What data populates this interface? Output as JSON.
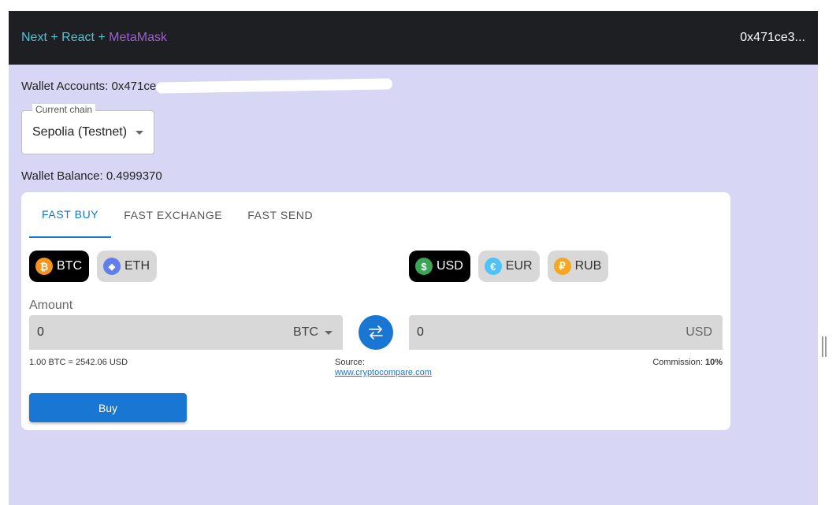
{
  "header": {
    "brand_part1": "Next + React + ",
    "brand_part2": "MetaMask",
    "account_short": "0x471ce3..."
  },
  "wallet": {
    "accounts_label": "Wallet Accounts: 0x471ce",
    "balance_label": "Wallet Balance: 0.4999370"
  },
  "chain_select": {
    "legend": "Current chain",
    "value": "Sepolia (Testnet)"
  },
  "tabs": [
    {
      "label": "FAST BUY",
      "active": true
    },
    {
      "label": "FAST EXCHANGE",
      "active": false
    },
    {
      "label": "FAST SEND",
      "active": false
    }
  ],
  "crypto_chips": [
    {
      "label": "BTC",
      "icon": "bitcoin-icon",
      "symbol": "₿",
      "color": "#f7931a",
      "active": true
    },
    {
      "label": "ETH",
      "icon": "ethereum-icon",
      "symbol": "◆",
      "color": "#627eea",
      "active": false
    }
  ],
  "fiat_chips": [
    {
      "label": "USD",
      "icon": "dollar-icon",
      "symbol": "$",
      "color": "#3aa655",
      "active": true
    },
    {
      "label": "EUR",
      "icon": "euro-icon",
      "symbol": "€",
      "color": "#4fc3f7",
      "active": false
    },
    {
      "label": "RUB",
      "icon": "ruble-icon",
      "symbol": "₽",
      "color": "#f5a623",
      "active": false
    }
  ],
  "exchange": {
    "amount_label": "Amount",
    "from_value": "0",
    "from_unit": "BTC",
    "to_value": "0",
    "to_unit": "USD",
    "rate_text": "1.00 BTC = 2542.06 USD",
    "source_label": "Source:",
    "source_link": "www.cryptocompare.com",
    "commission_label": "Commission:",
    "commission_value": "10%",
    "buy_label": "Buy"
  },
  "colors": {
    "accent": "#1976d2",
    "page_bg": "#d7d7f5",
    "appbar_bg": "#1e1f22"
  }
}
